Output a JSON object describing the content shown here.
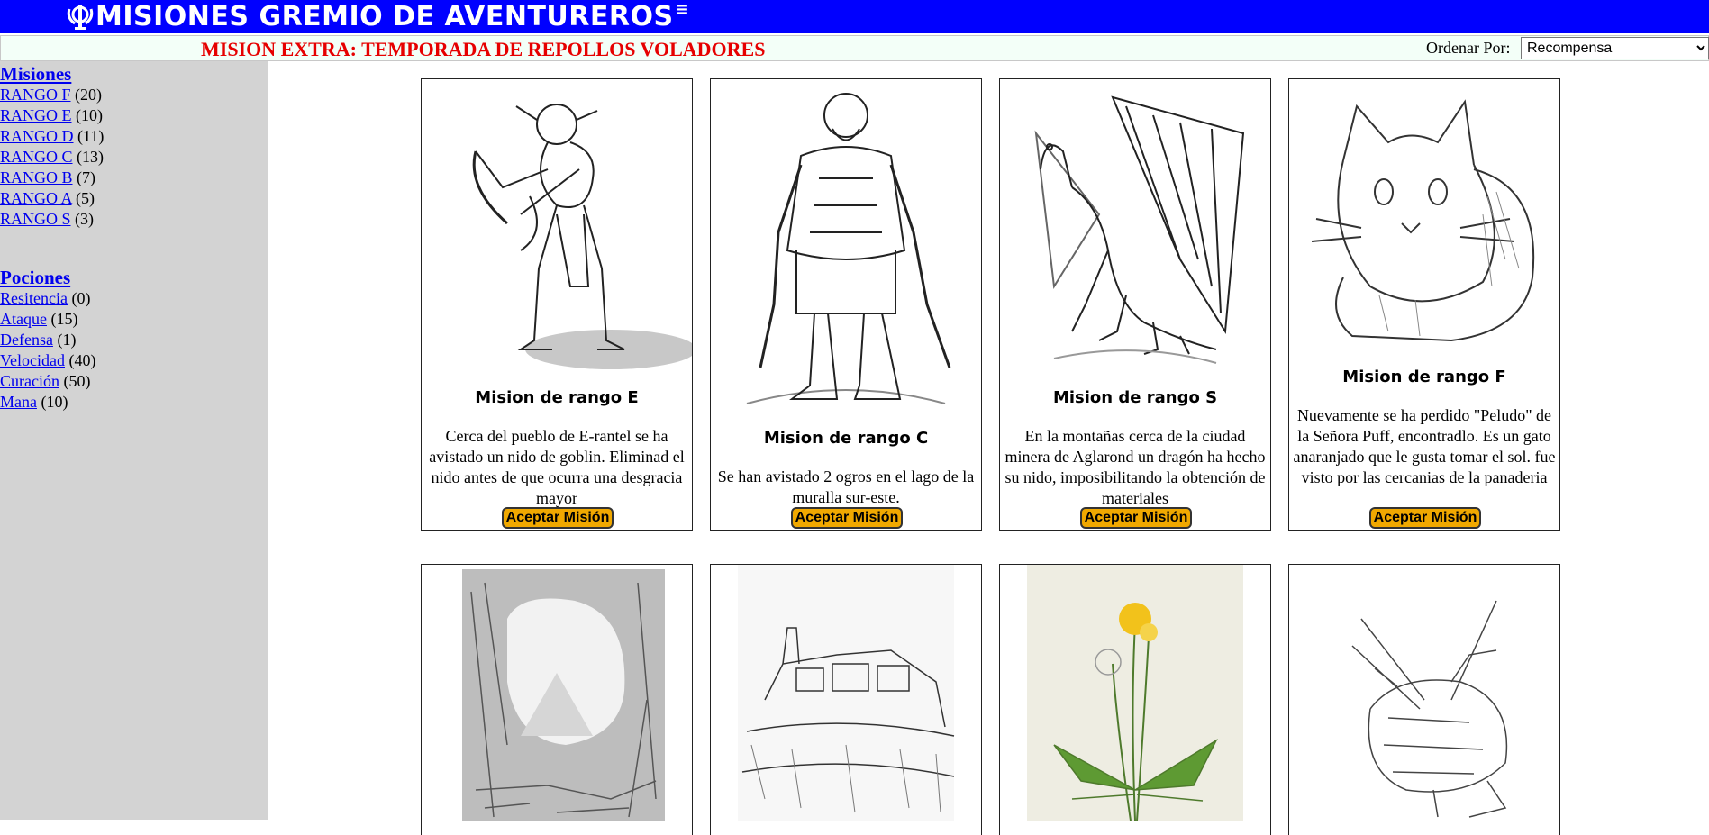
{
  "header": {
    "title": "MISIONES GREMIO DE AVENTUREROS",
    "brand_color": "#0000ff"
  },
  "notice": {
    "text": "MISION EXTRA: TEMPORADA DE REPOLLOS VOLADORES",
    "color": "#e60000"
  },
  "sort": {
    "label": "Ordenar Por:",
    "selected": "Recompensa"
  },
  "sidebar": {
    "misiones": {
      "title": "Misiones",
      "items": [
        {
          "label": "RANGO F",
          "count": "(20)"
        },
        {
          "label": "RANGO E",
          "count": "(10)"
        },
        {
          "label": "RANGO D",
          "count": "(11)"
        },
        {
          "label": "RANGO C",
          "count": "(13)"
        },
        {
          "label": "RANGO B",
          "count": "(7)"
        },
        {
          "label": "RANGO A",
          "count": "(5)"
        },
        {
          "label": "RANGO S",
          "count": "(3)"
        }
      ]
    },
    "pociones": {
      "title": "Pociones",
      "items": [
        {
          "label": "Resitencia",
          "count": "(0)"
        },
        {
          "label": "Ataque",
          "count": "(15)"
        },
        {
          "label": "Defensa",
          "count": "(1)"
        },
        {
          "label": "Velocidad",
          "count": "(40)"
        },
        {
          "label": "Curación",
          "count": "(50)"
        },
        {
          "label": "Mana",
          "count": "(10)"
        }
      ]
    }
  },
  "missions": [
    {
      "title": "Mision de rango E",
      "image": "goblin-illustration",
      "description": "Cerca del pueblo de E-rantel se ha avistado un nido de goblin. Eliminad el nido antes de que ocurra una desgracia mayor",
      "button": "Aceptar Misión"
    },
    {
      "title": "Mision de rango C",
      "image": "ogre-illustration",
      "description": "Se han avistado 2 ogros en el lago de la muralla sur-este.",
      "button": "Aceptar Misión"
    },
    {
      "title": "Mision de rango S",
      "image": "dragon-illustration",
      "description": "En la montañas cerca de la ciudad minera de Aglarond un dragón ha hecho su nido, imposibilitando la obtención de materiales",
      "button": "Aceptar Misión"
    },
    {
      "title": "Mision de rango F",
      "image": "cat-illustration",
      "description": "Nuevamente se ha perdido \"Peludo\" de la Señora Puff, encontradlo. Es un gato anaranjado que le gusta tomar el sol. fue visto por las cercanias de la panaderia",
      "button": "Aceptar Misión"
    }
  ],
  "missions_row2": [
    {
      "image": "cave-illustration"
    },
    {
      "image": "village-illustration"
    },
    {
      "image": "dandelion-illustration"
    },
    {
      "image": "crayfish-illustration"
    }
  ]
}
